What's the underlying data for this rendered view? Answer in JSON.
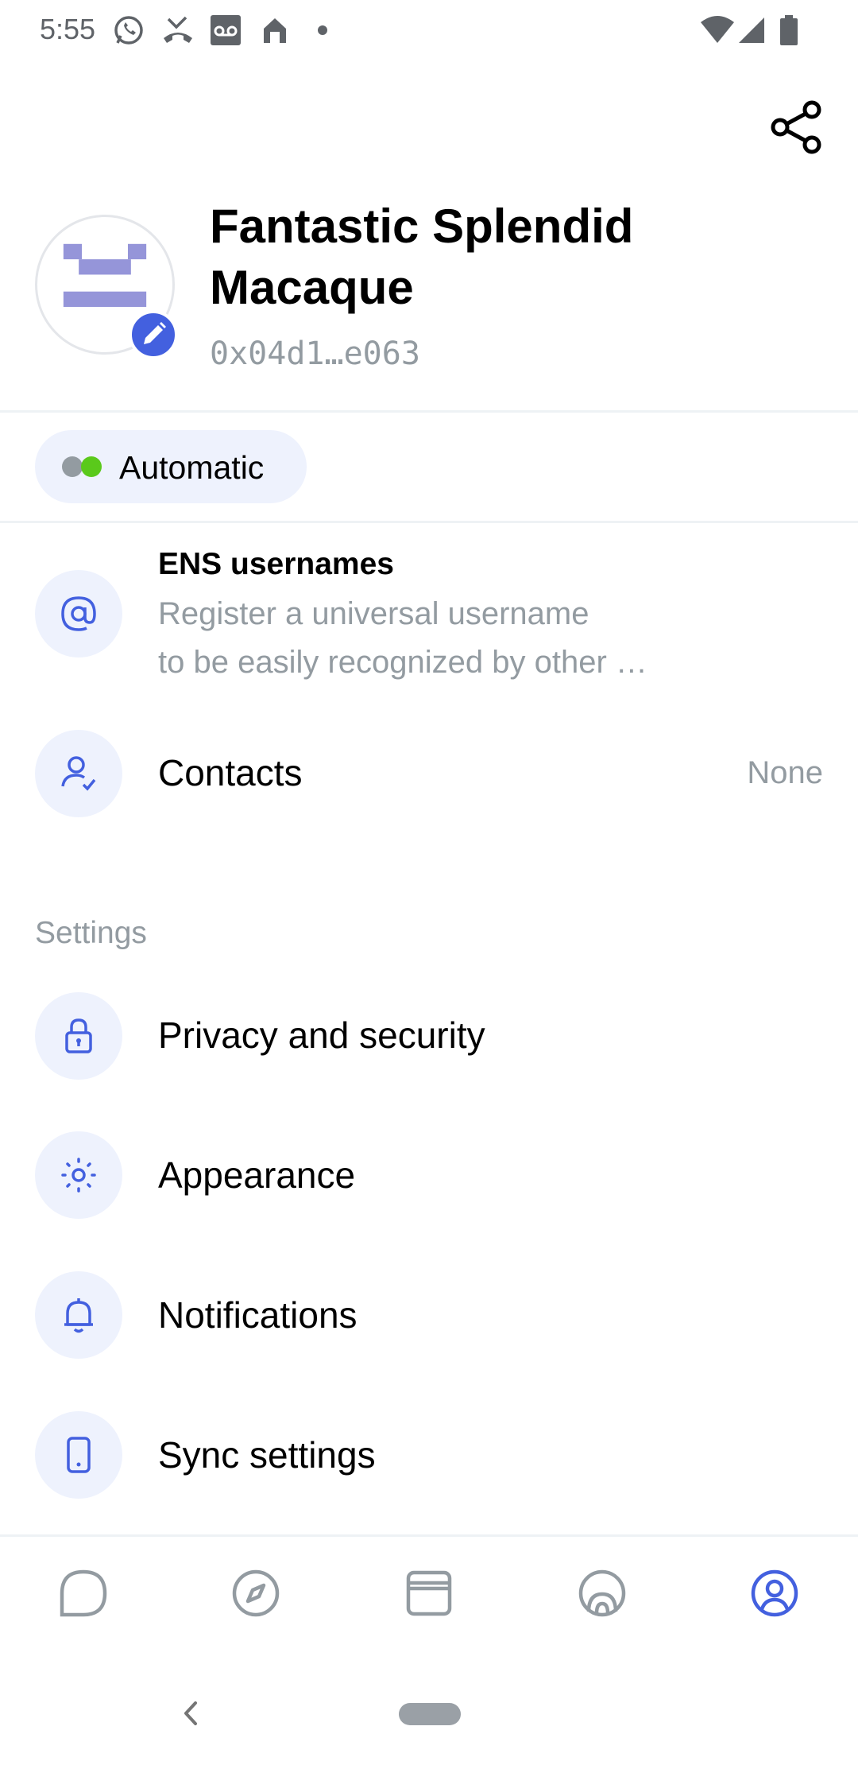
{
  "status_bar": {
    "time": "5:55",
    "icons": [
      "whatsapp-icon",
      "missed-call-icon",
      "voicemail-icon",
      "home-icon",
      "dot-icon",
      "wifi-icon",
      "signal-icon",
      "battery-icon"
    ]
  },
  "header": {
    "share_icon": "share-icon"
  },
  "profile": {
    "display_name": "Fantastic Splendid Macaque",
    "address": "0x04d1…e063",
    "avatar_color": "#9595d9",
    "edit_badge_color": "#4360df"
  },
  "status": {
    "label": "Automatic"
  },
  "rows": {
    "ens": {
      "title": "ENS usernames",
      "subtitle_line1": "Register a universal username",
      "subtitle_line2": "to be easily recognized by other …",
      "icon": "at-icon"
    },
    "contacts": {
      "title": "Contacts",
      "value": "None",
      "icon": "contact-check-icon"
    }
  },
  "settings": {
    "section_label": "Settings",
    "items": [
      {
        "label": "Privacy and security",
        "icon": "lock-icon"
      },
      {
        "label": "Appearance",
        "icon": "sun-icon"
      },
      {
        "label": "Notifications",
        "icon": "bell-icon"
      },
      {
        "label": "Sync settings",
        "icon": "phone-icon"
      }
    ]
  },
  "bottom_nav": {
    "items": [
      "chat-icon",
      "browser-compass-icon",
      "wallet-icon",
      "status-icon",
      "profile-icon"
    ],
    "active": "profile-icon",
    "accent": "#4360df",
    "inactive": "#939ba1"
  },
  "theme": {
    "accent": "#4360df",
    "icon_bg": "#eef2fd",
    "secondary_text": "#939ba1"
  }
}
